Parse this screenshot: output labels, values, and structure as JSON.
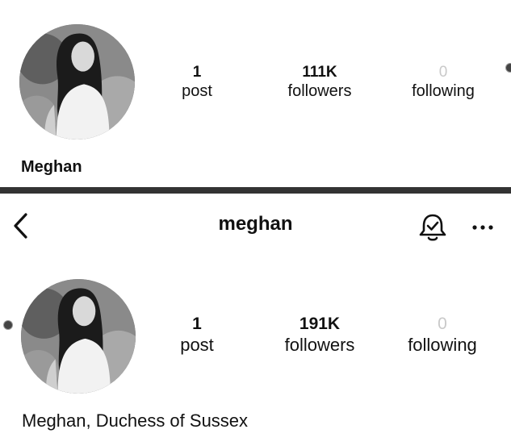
{
  "top": {
    "stats": [
      {
        "value": "1",
        "label": "post"
      },
      {
        "value": "111K",
        "label": "followers"
      },
      {
        "value": "0",
        "label": "following"
      }
    ],
    "display_name": "Meghan"
  },
  "bottom": {
    "header": {
      "username": "meghan",
      "back_icon": "chevron-left-icon",
      "bell_icon": "bell-check-icon",
      "more_icon": "more-horizontal-icon"
    },
    "stats": [
      {
        "value": "1",
        "label": "post"
      },
      {
        "value": "191K",
        "label": "followers"
      },
      {
        "value": "0",
        "label": "following"
      }
    ],
    "display_name": "Meghan, Duchess of Sussex"
  }
}
